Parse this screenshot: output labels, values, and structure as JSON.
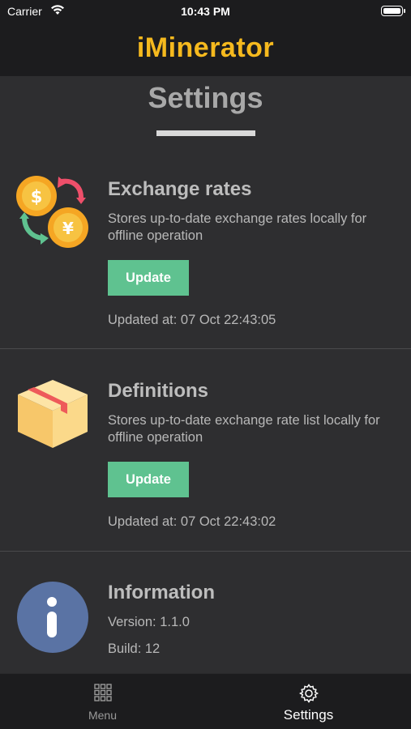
{
  "status_bar": {
    "carrier": "Carrier",
    "time": "10:43 PM",
    "wifi_icon": "wifi-icon",
    "battery_icon": "battery-icon"
  },
  "header": {
    "app_title": "iMinerator",
    "title_color": "#f5b91e"
  },
  "page": {
    "title": "Settings"
  },
  "sections": [
    {
      "icon": "currency-exchange-icon",
      "title": "Exchange rates",
      "description": "Stores up-to-date exchange rates locally for offline operation",
      "button_label": "Update",
      "updated_at": "Updated at: 07 Oct 22:43:05"
    },
    {
      "icon": "box-icon",
      "title": "Definitions",
      "description": "Stores up-to-date exchange rate list locally for offline operation",
      "button_label": "Update",
      "updated_at": "Updated at: 07 Oct 22:43:02"
    },
    {
      "icon": "info-icon",
      "title": "Information",
      "version": "Version: 1.1.0",
      "build": "Build: 12"
    }
  ],
  "tab_bar": {
    "tabs": [
      {
        "label": "Menu",
        "icon": "grid-icon",
        "active": false
      },
      {
        "label": "Settings",
        "icon": "gear-icon",
        "active": true
      }
    ]
  },
  "colors": {
    "accent": "#f5b91e",
    "button": "#5fc290",
    "background": "#2e2e30",
    "bar": "#1c1c1e"
  }
}
